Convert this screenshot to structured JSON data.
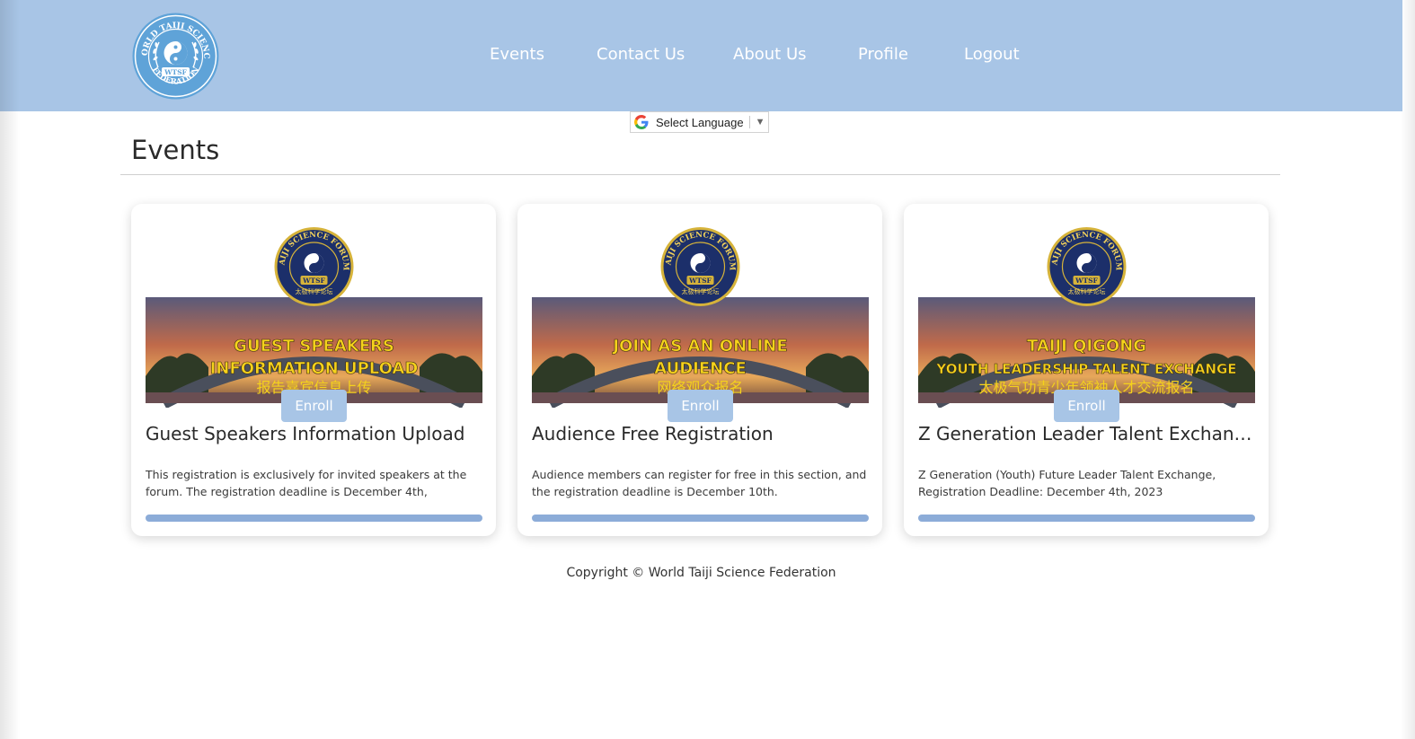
{
  "header": {
    "logo_text_top": "WORLD TAIJI SCIENCE",
    "logo_text_mid": "WTSF",
    "logo_text_bottom": "FEDERATION",
    "nav": [
      {
        "label": "Events"
      },
      {
        "label": "Contact Us"
      },
      {
        "label": "About Us"
      },
      {
        "label": "Profile"
      },
      {
        "label": "Logout"
      }
    ]
  },
  "language_select": {
    "label": "Select Language",
    "arrow": "▼"
  },
  "page": {
    "title": "Events"
  },
  "events": [
    {
      "banner_line1": "Guest Speakers",
      "banner_line2": "Information Upload",
      "banner_cn": "报告嘉宾信息上传",
      "badge_top": "TAIJI SCIENCE FORUM",
      "badge_mid": "WTSF",
      "badge_cn": "太极科学论坛",
      "enroll_label": "Enroll",
      "title": "Guest Speakers Information Upload",
      "description": "This registration is exclusively for invited speakers at the forum. The registration deadline is December 4th,"
    },
    {
      "banner_line1": "Join as an online",
      "banner_line2": "audience",
      "banner_cn": "网络观众报名",
      "badge_top": "TAIJI SCIENCE FORUM",
      "badge_mid": "WTSF",
      "badge_cn": "太极科学论坛",
      "enroll_label": "Enroll",
      "title": "Audience Free Registration",
      "description": "Audience members can register for free in this section, and the registration deadline is December 10th."
    },
    {
      "banner_line1": "Taiji Qigong",
      "banner_line2": "Youth Leadership Talent Exchange",
      "banner_cn": "太极气功青少年领袖人才交流报名",
      "badge_top": "TAIJI SCIENCE FORUM",
      "badge_mid": "WTSF",
      "badge_cn": "太极科学论坛",
      "enroll_label": "Enroll",
      "title": "Z Generation Leader Talent Exchange",
      "description": "Z Generation (Youth) Future Leader Talent Exchange, Registration Deadline: December 4th, 2023"
    }
  ],
  "footer": {
    "copyright": "Copyright © World Taiji Science Federation"
  },
  "colors": {
    "header_bg": "#a8c5e6",
    "accent": "#8cacd8",
    "banner_text": "#f5d21c",
    "badge_navy": "#1c2f6a"
  }
}
